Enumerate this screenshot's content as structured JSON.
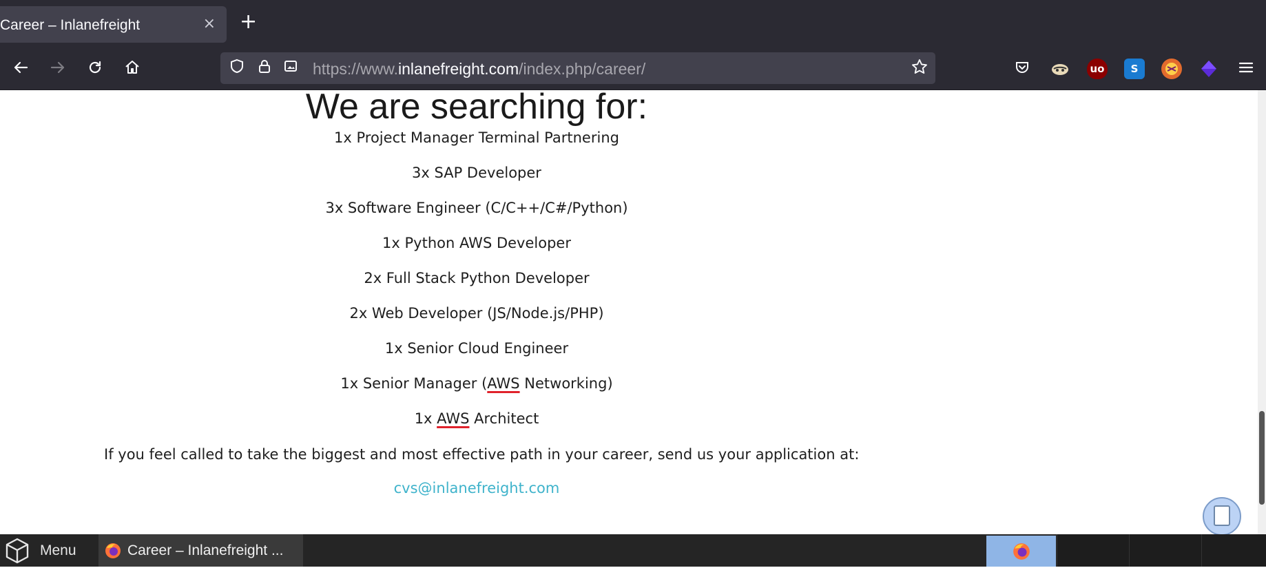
{
  "browser": {
    "tab": {
      "title": "Career – Inlanefreight",
      "close_glyph": "×"
    },
    "new_tab_glyph": "+",
    "url": {
      "prefix": "https://www.",
      "domain": "inlanefreight.com",
      "path": "/index.php/career/"
    },
    "nav_icons": [
      "back-icon",
      "forward-icon",
      "reload-icon",
      "home-icon"
    ],
    "url_icons": [
      "shield-icon",
      "lock-icon",
      "image-permission-icon",
      "star-icon"
    ],
    "extensions": [
      "pocket-icon",
      "hacker-extension-icon",
      "ublock-icon",
      "s-extension-icon",
      "firefox-ext-icon",
      "purple-cube-icon",
      "menu-icon"
    ],
    "accent_colors": {
      "ublock": "#8b0000",
      "s_ext": "#1a7bd1",
      "link": "#3fb3cb",
      "spellcheck": "#e0222b"
    }
  },
  "page": {
    "heading": "We are searching for:",
    "jobs": [
      {
        "pre": "1x Project Manager Terminal Partnering",
        "flag": "",
        "post": ""
      },
      {
        "pre": "3x SAP Developer",
        "flag": "",
        "post": ""
      },
      {
        "pre": "3x Software Engineer (C/C++/C#/Python)",
        "flag": "",
        "post": ""
      },
      {
        "pre": "1x Python AWS Developer",
        "flag": "",
        "post": ""
      },
      {
        "pre": "2x Full Stack Python Developer",
        "flag": "",
        "post": ""
      },
      {
        "pre": "2x Web Developer (JS/Node.js/PHP)",
        "flag": "",
        "post": ""
      },
      {
        "pre": "1x Senior Cloud Engineer",
        "flag": "",
        "post": ""
      },
      {
        "pre": "1x Senior Manager (",
        "flag": "AWS",
        "post": " Networking)"
      },
      {
        "pre": "1x ",
        "flag": "AWS",
        "post": " Architect"
      }
    ],
    "call_to_action": "If you feel called to take the biggest and most effective path in your career, send us your application at:",
    "email": "cvs@inlanefreight.com"
  },
  "taskbar": {
    "menu_label": "Menu",
    "task_label": "Career – Inlanefreight ..."
  }
}
